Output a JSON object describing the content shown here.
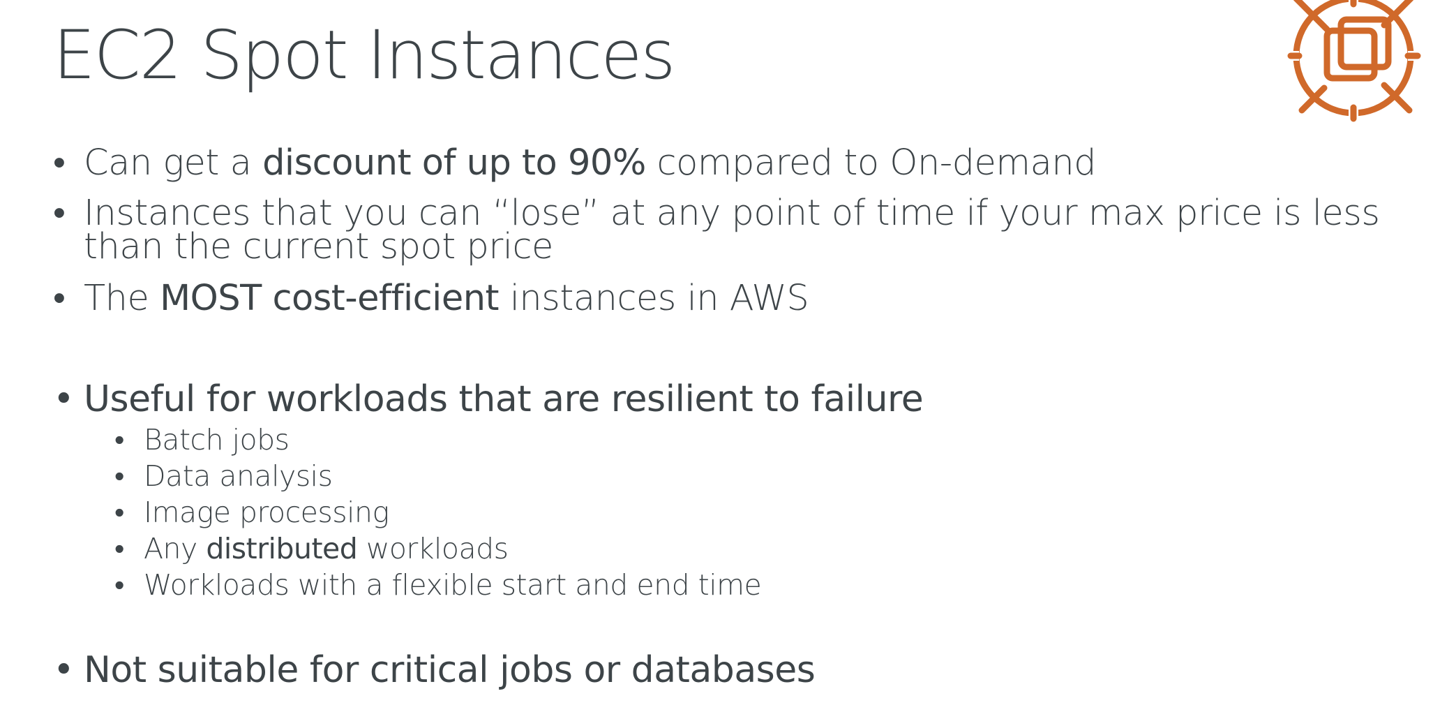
{
  "title": "EC2 Spot Instances",
  "accent_color": "#d0692a",
  "text_color": "#3d4448",
  "logo": {
    "icon": "ec2-spot-instance-icon"
  },
  "bullets": [
    {
      "pre": "Can get a ",
      "bold": "discount of up to 90%",
      "post": " compared to On-demand"
    },
    {
      "text": "Instances that you can “lose” at any point of time if your max price is less than the current spot price"
    },
    {
      "pre": "The ",
      "bold": "MOST cost-efficient",
      "post": " instances in AWS"
    },
    {
      "text": "Useful for workloads that are resilient to failure",
      "sub": [
        {
          "text": "Batch jobs"
        },
        {
          "text": "Data analysis"
        },
        {
          "text": "Image processing"
        },
        {
          "pre": "Any ",
          "bold": "distributed",
          "post": " workloads"
        },
        {
          "text": "Workloads with a flexible start and end time"
        }
      ]
    },
    {
      "text": "Not suitable for critical jobs or databases"
    }
  ]
}
